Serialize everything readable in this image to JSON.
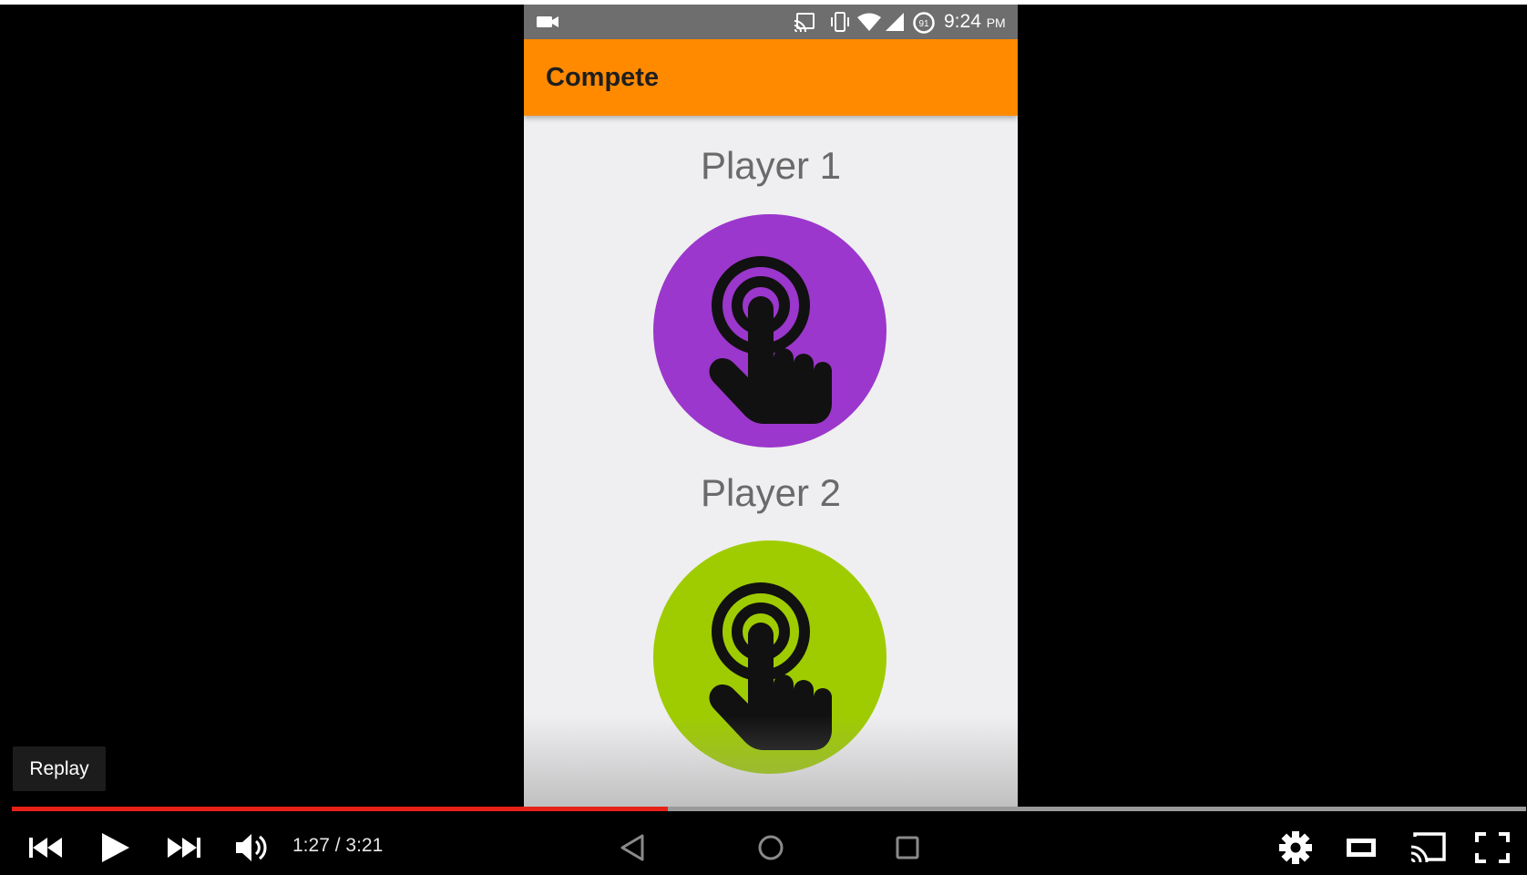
{
  "status_bar": {
    "time": "9:24",
    "ampm": "PM",
    "battery_level": "91",
    "icons": [
      "video-camera-icon",
      "cast-icon",
      "vibrate-icon",
      "wifi-icon",
      "signal-icon",
      "battery-icon"
    ]
  },
  "app": {
    "title": "Compete",
    "accent_color": "#ff8a00",
    "players": [
      {
        "label": "Player 1",
        "button_color": "#9b37cc",
        "icon": "tap-hand-icon"
      },
      {
        "label": "Player 2",
        "button_color": "#9fcc00",
        "icon": "tap-hand-icon"
      }
    ]
  },
  "android_nav": {
    "icons": [
      "back-nav-icon",
      "home-nav-icon",
      "recents-nav-icon"
    ]
  },
  "video_player": {
    "replay_label": "Replay",
    "current_time": "1:27",
    "duration": "3:21",
    "time_display": "1:27 / 3:21",
    "played_fraction": 0.433,
    "progress_color": "#e62117",
    "controls": [
      "previous-icon",
      "play-icon",
      "next-icon",
      "volume-icon",
      "settings-icon",
      "theater-mode-icon",
      "cast-icon",
      "fullscreen-icon"
    ]
  }
}
